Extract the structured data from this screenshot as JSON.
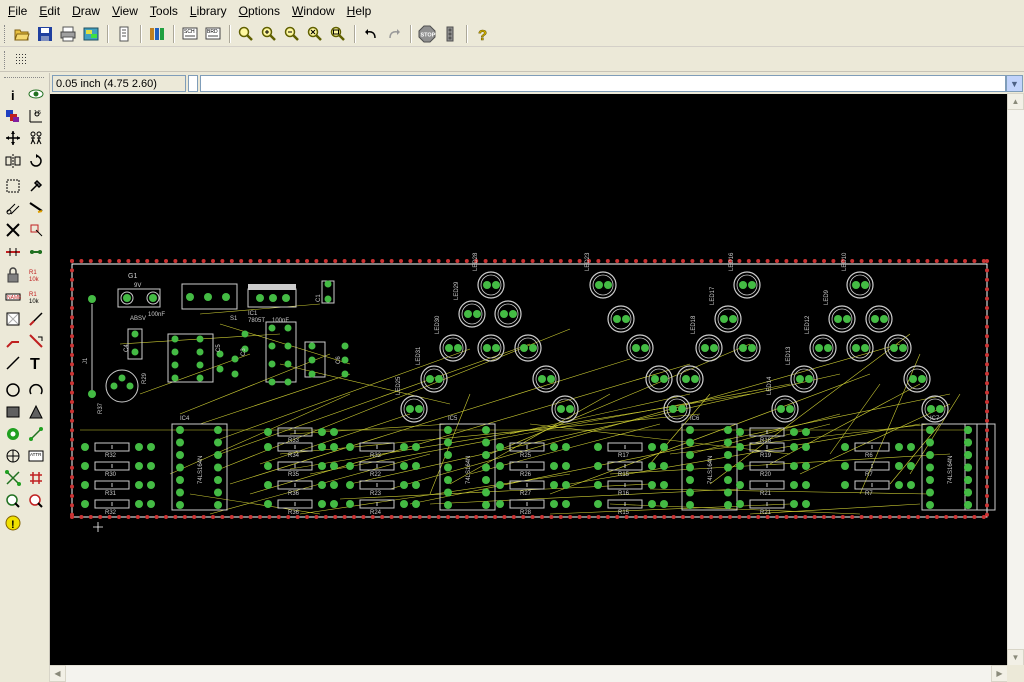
{
  "menu": [
    {
      "label": "File",
      "acc": "F",
      "rest": "ile"
    },
    {
      "label": "Edit",
      "acc": "E",
      "rest": "dit"
    },
    {
      "label": "Draw",
      "acc": "D",
      "rest": "raw"
    },
    {
      "label": "View",
      "acc": "V",
      "rest": "iew"
    },
    {
      "label": "Tools",
      "acc": "T",
      "rest": "ools"
    },
    {
      "label": "Library",
      "acc": "L",
      "rest": "ibrary"
    },
    {
      "label": "Options",
      "acc": "O",
      "rest": "ptions"
    },
    {
      "label": "Window",
      "acc": "W",
      "rest": "indow"
    },
    {
      "label": "Help",
      "acc": "H",
      "rest": "elp"
    }
  ],
  "coords": {
    "display": "0.05 inch (4.75 2.60)"
  },
  "command": {
    "value": "",
    "placeholder": ""
  },
  "colors": {
    "canvas": "#000000",
    "board_outline": "#ffffff",
    "dimension_dots": "#cc3333",
    "pad": "#44bb44",
    "airwire": "#cccc33",
    "silkscreen": "#cccccc"
  },
  "board": {
    "top_labels": [
      "G1",
      "9V",
      "ABSV",
      "100nF",
      "S1",
      "IC1",
      "7805T",
      "100nF",
      "C1",
      "R29",
      "R37",
      "J1",
      "C3",
      "C4",
      "C5",
      "C6"
    ],
    "ic_labels": [
      "IC4",
      "IC5",
      "IC6",
      "IC7"
    ],
    "ic_parts": [
      "74LS164N",
      "74LS164N",
      "74LS164N",
      "74LS164N"
    ],
    "led_labels": [
      "LED28",
      "LED29",
      "LED30",
      "LED31",
      "LED25",
      "LED23",
      "LED16",
      "LED17",
      "LED18",
      "LED10",
      "LED9",
      "LED12",
      "LED13",
      "LED14"
    ],
    "resistor_labels": [
      "R32",
      "R30",
      "R31",
      "R33",
      "R34",
      "R35",
      "R36",
      "R32",
      "R22",
      "R23",
      "R24",
      "R25",
      "R26",
      "R27",
      "R28",
      "R17",
      "R15",
      "R16",
      "R18",
      "R19",
      "R20",
      "R21",
      "R6",
      "R7"
    ]
  }
}
